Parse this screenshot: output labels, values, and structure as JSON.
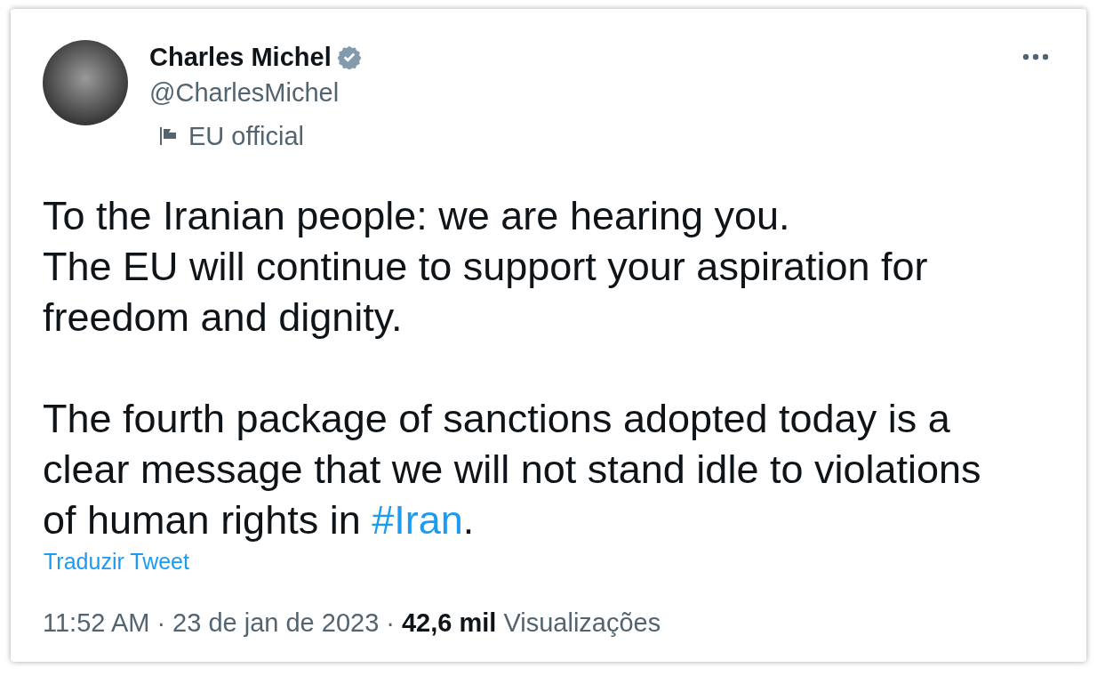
{
  "author": {
    "name": "Charles Michel",
    "verified": true,
    "handle": "@CharlesMichel",
    "label": "EU official"
  },
  "tweet_text": [
    {
      "lines": [
        [
          {
            "kind": "text",
            "text": "To the Iranian people: we are hearing you."
          }
        ],
        [
          {
            "kind": "text",
            "text": "The EU will continue to support your aspiration for"
          }
        ],
        [
          {
            "kind": "text",
            "text": "freedom and dignity."
          }
        ]
      ]
    },
    {
      "lines": [
        [
          {
            "kind": "text",
            "text": "The fourth package of sanctions adopted today is a"
          }
        ],
        [
          {
            "kind": "text",
            "text": "clear message that we will not stand idle to violations"
          }
        ],
        [
          {
            "kind": "text",
            "text": "of human rights in "
          },
          {
            "kind": "hashtag",
            "text": "#Iran"
          },
          {
            "kind": "text",
            "text": "."
          }
        ]
      ]
    }
  ],
  "translate_link": "Traduzir Tweet",
  "footer": {
    "time": "11:52 AM",
    "separator_1": "·",
    "date": "23 de jan de 2023",
    "separator_2": "·",
    "views_count": "42,6 mil",
    "views_label": "Visualizações"
  }
}
